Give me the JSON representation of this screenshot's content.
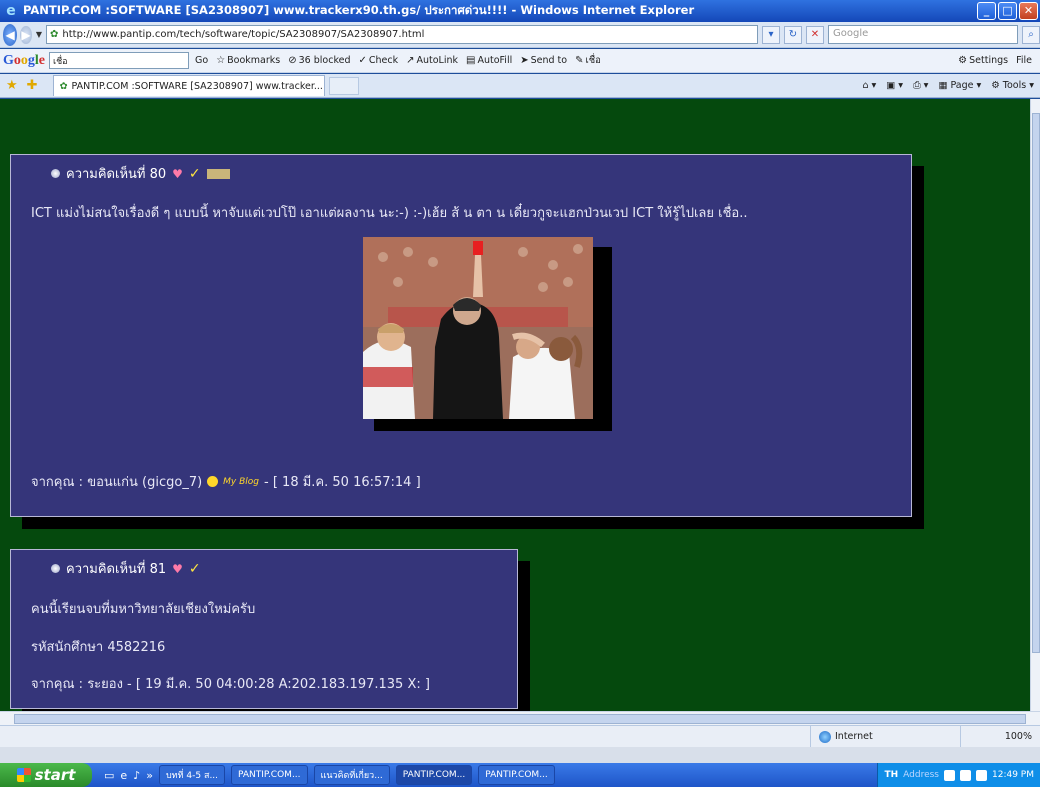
{
  "window": {
    "title": "PANTIP.COM :SOFTWARE [SA2308907] www.trackerx90.th.gs/ ประกาศด่วน!!!! - Windows Internet Explorer"
  },
  "address_bar": {
    "url": "http://www.pantip.com/tech/software/topic/SA2308907/SA2308907.html",
    "search_placeholder": "Google"
  },
  "google_toolbar": {
    "search_value": "เชื่อ",
    "go_label": "Go",
    "bookmarks_label": "Bookmarks",
    "blocked_label": "36 blocked",
    "check_label": "Check",
    "autolink_label": "AutoLink",
    "autofill_label": "AutoFill",
    "sendto_label": "Send to",
    "highlight_label": "เชื่อ",
    "settings_label": "Settings",
    "file_label": "File"
  },
  "tabs": {
    "active_label": "PANTIP.COM :SOFTWARE [SA2308907] www.tracker...",
    "page_label": "Page",
    "tools_label": "Tools"
  },
  "posts": [
    {
      "heading": "ความคิดเห็นที่ 80",
      "body": "ICT  แม่งไม่สนใจเรื่องดี ๆ แบบนี้ หาจับแต่เวปโป๊ เอาแต่ผลงาน นะ:-) :-)เฮ้ย ส้ น ตา น เดี๋ยวกูจะแฮกป่วนเวป ICT ให้รู้ไปเลย เชื่อ..",
      "footer_from": "จากคุณ : ขอนแก่น (gicgo_7)",
      "footer_blog": "My Blog",
      "footer_date": "- [ 18 มี.ค. 50 16:57:14 ]"
    },
    {
      "heading": "ความคิดเห็นที่ 81",
      "line1": "คนนี้เรียนจบที่มหาวิทยาลัยเชียงใหม่ครับ",
      "line2": "รหัสนักศึกษา 4582216",
      "line3": "จากคุณ : ระยอง - [ 19 มี.ค. 50 04:00:28 A:202.183.197.135 X: ]"
    }
  ],
  "status_bar": {
    "zone": "Internet",
    "zoom": "100%"
  },
  "taskbar": {
    "start_label": "start",
    "tasks": [
      "บทที่ 4-5 ส...",
      "PANTIP.COM...",
      "แนวคิดที่เกี่ยว...",
      "PANTIP.COM...",
      "PANTIP.COM..."
    ],
    "lang": "TH",
    "address_label": "Address",
    "clock": "12:49 PM"
  }
}
